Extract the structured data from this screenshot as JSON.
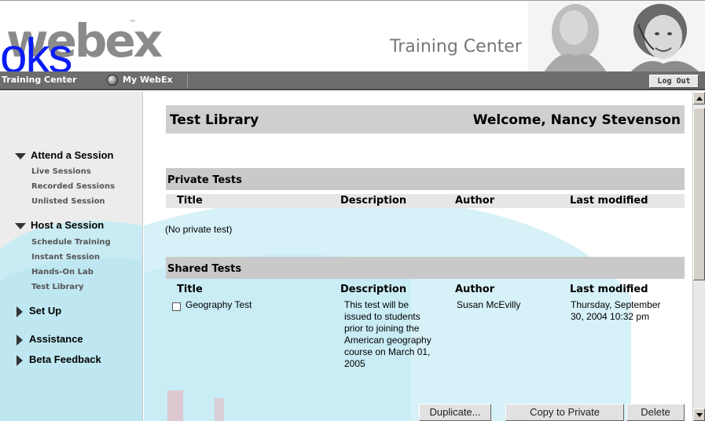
{
  "header": {
    "logo_text": "webex",
    "logo_overlay_text": "oks",
    "product_title": "Training Center"
  },
  "nav": {
    "training_center": "Training Center",
    "my_webex": "My WebEx",
    "logout": "Log Out"
  },
  "sidebar": {
    "sections": [
      {
        "label": "Attend a Session",
        "expanded": true,
        "items": [
          "Live Sessions",
          "Recorded Sessions",
          "Unlisted Session"
        ]
      },
      {
        "label": "Host a Session",
        "expanded": true,
        "items": [
          "Schedule Training",
          "Instant Session",
          "Hands-On Lab",
          "Test Library"
        ]
      },
      {
        "label": "Set Up",
        "expanded": false,
        "items": []
      },
      {
        "label": "Assistance",
        "expanded": false,
        "items": []
      },
      {
        "label": "Beta Feedback",
        "expanded": false,
        "items": []
      }
    ]
  },
  "main": {
    "page_title": "Test Library",
    "welcome": "Welcome, Nancy Stevenson",
    "columns": [
      "Title",
      "Description",
      "Author",
      "Last modified"
    ],
    "private_tests": {
      "heading": "Private Tests",
      "empty_text": "(No private test)"
    },
    "shared_tests": {
      "heading": "Shared Tests",
      "rows": [
        {
          "title": "Geography Test",
          "description_lines": [
            "This test will be",
            "issued to students",
            "prior to joining the",
            "American geography",
            "course on March 01,",
            "2005"
          ],
          "author": "Susan McEvilly",
          "modified_lines": [
            "Thursday, September",
            "30, 2004 10:32 pm"
          ]
        }
      ]
    },
    "actions": {
      "duplicate": "Duplicate...",
      "copy_to_private": "Copy to Private",
      "delete": "Delete"
    }
  },
  "colors": {
    "nav_bg": "#6d6d6d",
    "section_header_bg": "#c9c9c9",
    "sidebar_bg": "#ececec",
    "swoosh_cyan": "#c9ecf4",
    "overlay_blue": "#0a1cf5"
  }
}
